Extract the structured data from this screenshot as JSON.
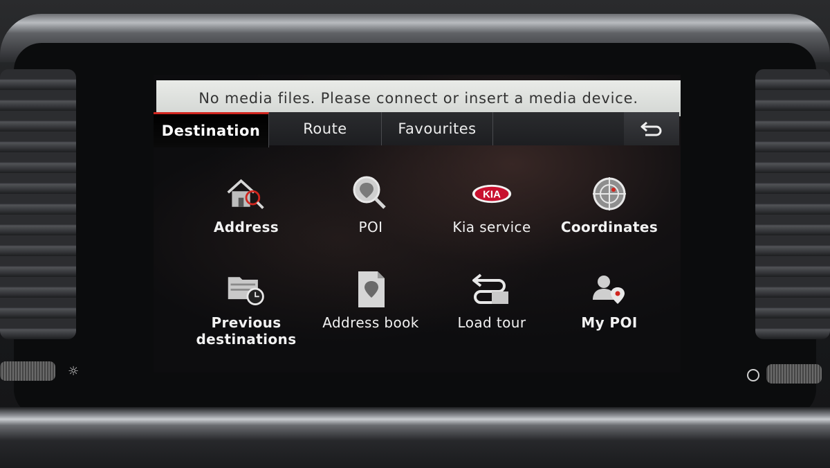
{
  "banner": {
    "message": "No media files. Please connect or insert a media device."
  },
  "tabs": [
    {
      "label": "Destination",
      "active": true
    },
    {
      "label": "Route",
      "active": false
    },
    {
      "label": "Favourites",
      "active": false
    }
  ],
  "back_icon": "return-arrow-icon",
  "menu": [
    {
      "label": "Address",
      "icon": "house-search-icon"
    },
    {
      "label": "POI",
      "icon": "poi-search-icon"
    },
    {
      "label": "Kia service",
      "icon": "kia-logo-icon",
      "logo_text": "KIA"
    },
    {
      "label": "Coordinates",
      "icon": "coordinates-target-icon"
    },
    {
      "label": "Previous destinations",
      "icon": "folder-clock-icon"
    },
    {
      "label": "Address book",
      "icon": "address-book-icon"
    },
    {
      "label": "Load tour",
      "icon": "load-tour-icon"
    },
    {
      "label": "My POI",
      "icon": "user-pin-icon"
    }
  ],
  "colors": {
    "accent": "#d0261f",
    "banner_bg": "#e0e2df",
    "tab_bg": "#24252a",
    "kia_red": "#c8102e"
  }
}
